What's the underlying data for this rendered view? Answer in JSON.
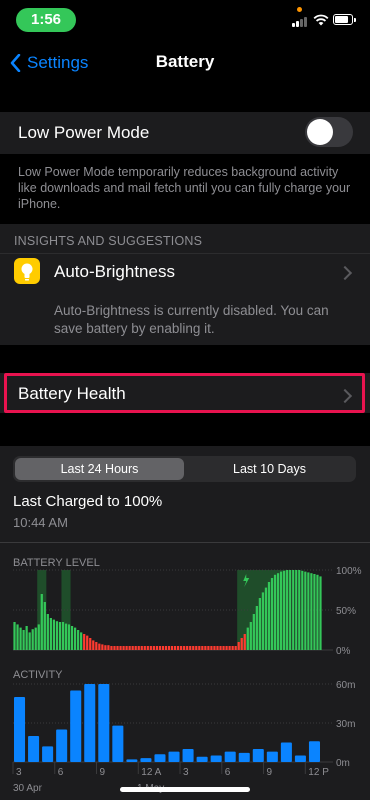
{
  "status": {
    "time": "1:56"
  },
  "nav": {
    "back_label": "Settings",
    "title": "Battery"
  },
  "low_power": {
    "label": "Low Power Mode",
    "enabled": false,
    "description": "Low Power Mode temporarily reduces background activity like downloads and mail fetch until you can fully charge your iPhone."
  },
  "insights": {
    "header": "INSIGHTS AND SUGGESTIONS",
    "item_label": "Auto-Brightness",
    "item_icon": "lightbulb-icon",
    "item_description": "Auto-Brightness is currently disabled. You can save battery by enabling it."
  },
  "battery_health": {
    "label": "Battery Health"
  },
  "period": {
    "options": [
      "Last 24 Hours",
      "Last 10 Days"
    ],
    "selected": "Last 24 Hours"
  },
  "last_charged": {
    "title": "Last Charged to 100%",
    "time": "10:44 AM"
  },
  "colors": {
    "accent": "#0a84ff",
    "level_green": "#34c759",
    "level_red": "#ff3b30",
    "activity_blue": "#0a84ff",
    "highlight": "#e8134f"
  },
  "chart_data": [
    {
      "type": "bar",
      "title": "BATTERY LEVEL",
      "y_ticks": [
        "100%",
        "50%",
        "0%"
      ],
      "ylim": [
        0,
        100
      ],
      "values": [
        35,
        32,
        28,
        25,
        30,
        22,
        26,
        28,
        32,
        70,
        60,
        45,
        40,
        38,
        36,
        35,
        35,
        33,
        32,
        30,
        28,
        25,
        22,
        20,
        18,
        15,
        12,
        10,
        8,
        7,
        6,
        6,
        5,
        5,
        5,
        5,
        5,
        5,
        5,
        5,
        5,
        5,
        5,
        5,
        5,
        5,
        5,
        5,
        5,
        5,
        5,
        5,
        5,
        5,
        5,
        5,
        5,
        5,
        5,
        5,
        5,
        5,
        5,
        5,
        5,
        5,
        5,
        5,
        5,
        5,
        5,
        5,
        5,
        5,
        10,
        15,
        20,
        28,
        35,
        45,
        55,
        65,
        72,
        78,
        85,
        90,
        94,
        96,
        98,
        99,
        100,
        100,
        100,
        100,
        100,
        99,
        98,
        97,
        96,
        95,
        94,
        92
      ],
      "low_threshold": 20,
      "charging_ranges": [
        [
          8,
          10
        ],
        [
          16,
          18
        ],
        [
          74,
          90
        ]
      ],
      "charge_icon_index": 76
    },
    {
      "type": "bar",
      "title": "ACTIVITY",
      "y_ticks": [
        "60m",
        "30m",
        "0m"
      ],
      "ylim": [
        0,
        60
      ],
      "values": [
        50,
        20,
        12,
        25,
        55,
        60,
        60,
        28,
        2,
        3,
        6,
        8,
        10,
        4,
        5,
        8,
        7,
        10,
        8,
        15,
        5,
        16
      ],
      "x_ticks": [
        "3",
        "6",
        "9",
        "12 A",
        "3",
        "6",
        "9",
        "12 P"
      ],
      "x_sublabels": [
        "30 Apr",
        "1 May"
      ]
    }
  ]
}
